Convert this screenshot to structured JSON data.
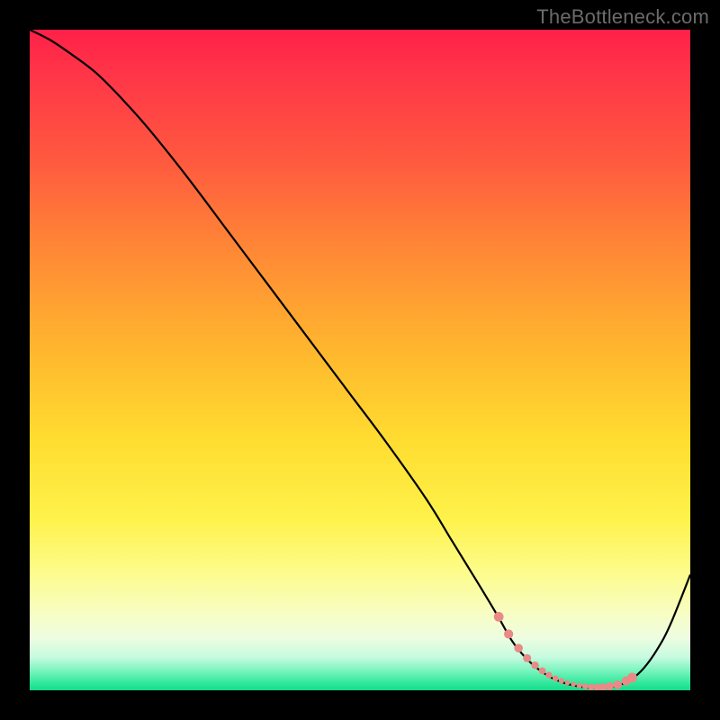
{
  "watermark": "TheBottleneck.com",
  "colors": {
    "curve": "#000000",
    "dots": "#e98a86",
    "frame": "#000000"
  },
  "chart_data": {
    "type": "line",
    "title": "",
    "xlabel": "",
    "ylabel": "",
    "xlim": [
      0,
      100
    ],
    "ylim": [
      0,
      100
    ],
    "grid": false,
    "legend": null,
    "notes": "Bottleneck-style curve: value descends from 100 near x=0 to ~0 over roughly x=73..90, then rises to ~18 at x=100. Salmon dotted markers sit on the valley floor (~x 71..91). Background gradient encodes value from red (high) to green (very bottom).",
    "series": [
      {
        "name": "curve",
        "x": [
          0,
          3,
          6,
          10,
          14,
          18,
          24,
          30,
          36,
          42,
          48,
          54,
          60,
          64,
          68,
          71,
          73,
          75,
          77,
          79,
          81,
          83,
          85,
          87,
          89,
          91,
          93,
          95,
          97,
          100
        ],
        "y": [
          100,
          98.5,
          96.5,
          93.5,
          89.5,
          85,
          77.5,
          69.5,
          61.5,
          53.5,
          45.5,
          37.5,
          29,
          22.5,
          16,
          11,
          7.5,
          5,
          3.2,
          1.9,
          1.1,
          0.6,
          0.35,
          0.35,
          0.7,
          1.6,
          3.4,
          6.2,
          10,
          17.5
        ]
      }
    ],
    "valley_markers_x": [
      71,
      72.5,
      74,
      75.3,
      76.5,
      77.6,
      78.6,
      79.6,
      80.5,
      81.4,
      82.3,
      83.2,
      84.1,
      85,
      85.9,
      86.8,
      87.8,
      89,
      90.3,
      91.2
    ]
  }
}
